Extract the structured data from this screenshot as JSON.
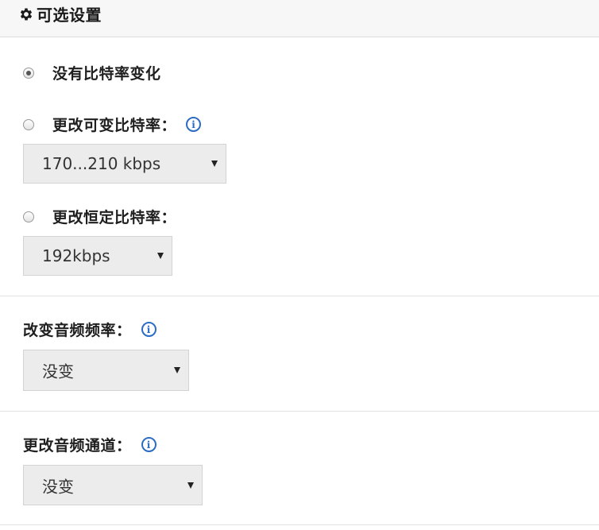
{
  "header": {
    "title": "可选设置",
    "icon": "gear-icon"
  },
  "bitrate": {
    "options": [
      {
        "label": "没有比特率变化",
        "checked": true
      },
      {
        "label": "更改可变比特率：",
        "checked": false
      },
      {
        "label": "更改恒定比特率：",
        "checked": false
      }
    ],
    "vbr_select": {
      "value": "170...210 kbps"
    },
    "cbr_select": {
      "value": "192kbps"
    }
  },
  "frequency": {
    "label": "改变音频频率：",
    "select_value": "没变"
  },
  "channel": {
    "label": "更改音频通道：",
    "select_value": "没变"
  },
  "colors": {
    "info_icon": "#2b6cc4",
    "select_bg": "#ececec"
  }
}
